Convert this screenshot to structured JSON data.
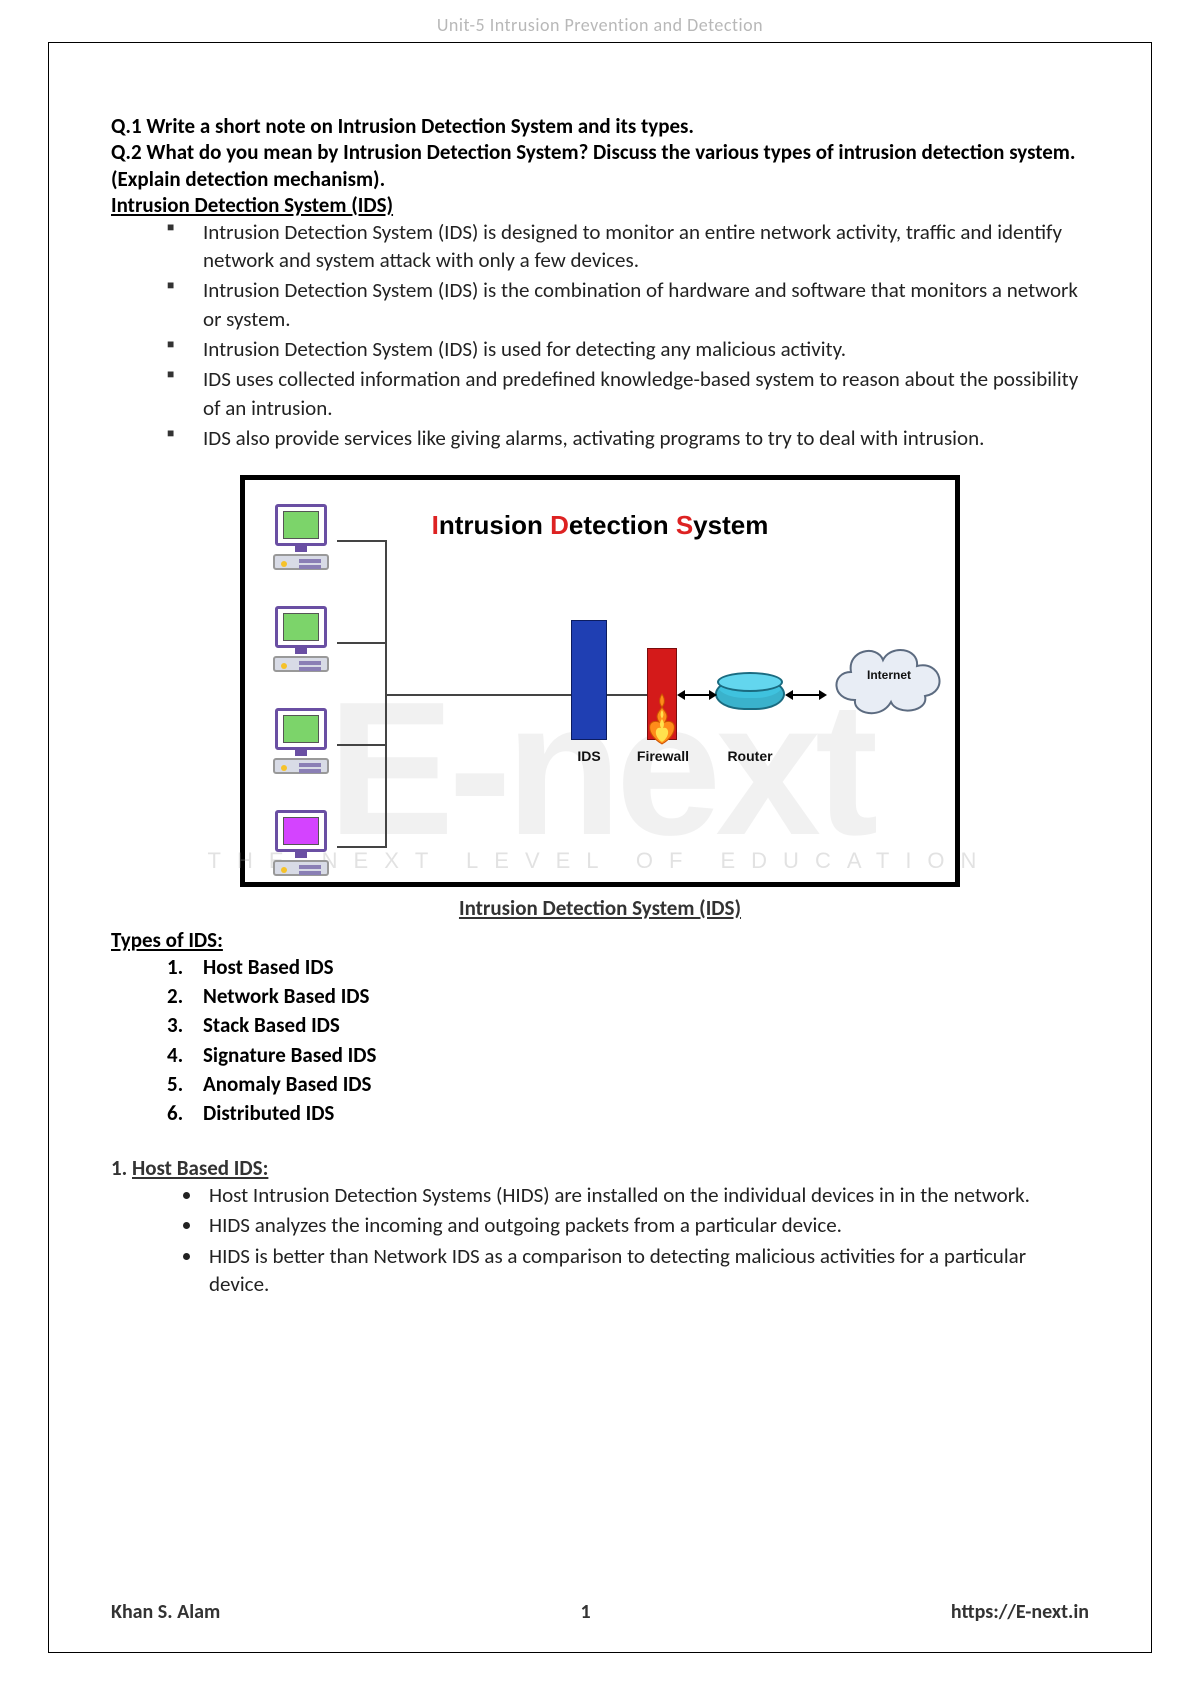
{
  "header": {
    "title": "Unit-5 Intrusion Prevention and Detection"
  },
  "questions": {
    "q1": "Q.1 Write a short note on Intrusion Detection System and its types.",
    "q2": "Q.2 What do you mean by Intrusion Detection System? Discuss the various types of intrusion detection system. (Explain detection mechanism)."
  },
  "section1": {
    "title": "Intrusion Detection System (IDS)",
    "bullets": [
      "Intrusion Detection System (IDS) is designed to monitor an entire network activity, traffic and identify network and system attack with only a few devices.",
      "Intrusion Detection System (IDS) is the combination of hardware and software that monitors a network or system.",
      "Intrusion Detection System (IDS) is used for detecting any malicious activity.",
      "IDS uses collected information and predefined knowledge-based system to reason about the possibility of an intrusion.",
      "IDS also provide services like giving alarms, activating programs to try to deal with intrusion."
    ]
  },
  "diagram": {
    "title_w1": "Intrusion",
    "title_w2": "Detection",
    "title_w3": "System",
    "labels": {
      "ids": "IDS",
      "firewall": "Firewall",
      "router": "Router",
      "internet": "Internet"
    },
    "watermark_big": "E-next",
    "watermark_small": "THE NEXT LEVEL OF EDUCATION"
  },
  "fig_caption": "Intrusion Detection System (IDS)",
  "types": {
    "heading": "Types of IDS:",
    "items": [
      "Host Based IDS",
      "Network Based IDS",
      "Stack Based IDS",
      "Signature Based IDS",
      "Anomaly Based IDS",
      "Distributed IDS"
    ]
  },
  "host": {
    "heading_prefix": "1. ",
    "heading": "Host Based IDS:",
    "bullets": [
      "Host Intrusion Detection Systems (HIDS) are installed on the individual devices in in the network.",
      "HIDS analyzes the incoming and outgoing packets from a particular device.",
      "HIDS is better than Network IDS as a comparison to detecting malicious activities for a particular device."
    ]
  },
  "footer": {
    "author": "Khan S. Alam",
    "page": "1",
    "site": "https://E-next.in"
  }
}
